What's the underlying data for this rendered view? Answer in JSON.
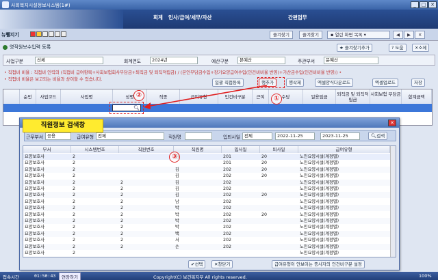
{
  "window": {
    "title": "사회복지시설정보시스템(1#)"
  },
  "menu": [
    "회계",
    "인사/급여/세무/자산",
    "간편업무"
  ],
  "nav": {
    "left_label": "뉴쀙지기",
    "buttons": [
      "즐겨찾기",
      "즐겨찾기",
      "열린 화면 목록"
    ]
  },
  "form": {
    "title": "영직원보수입력 등록",
    "fav_label": "즐겨찾기추가",
    "help_label": "도움",
    "close_label": "소제",
    "fields": [
      {
        "label": "사업구분",
        "value": "선체"
      },
      {
        "label": "회계연도",
        "value": "2024년"
      },
      {
        "label": "예산구분",
        "value": "본예산"
      },
      {
        "label": "주관부서",
        "value": "문예산"
      }
    ],
    "note1": "• 직접비 비율 : 직접비 인력의 (직접비 급여항목+사회보험회사부담금+퇴직금 및 퇴직적립금) / (본인부담금수입+장기요양급여수입(인건비비율 반영)+가산금수입(인건비비율 반영)) •",
    "note2": "• 직접비 비율은 보고되는 비율과 상이할 수 있습니다.",
    "buttons": [
      "일괄 직접등록",
      "행추가",
      "행삭제",
      "엑셀양식다운로드",
      "엑셀업로드",
      "저장"
    ]
  },
  "grid": {
    "headers": [
      "순번",
      "사업코드",
      "사업명",
      "성명",
      "직종",
      "급여유형",
      "인건비구분",
      "근여",
      "수당",
      "일용임금",
      "퇴직금 및 퇴직적립금",
      "사회보험 부담금",
      "합계금액"
    ]
  },
  "dialog": {
    "label": "직원정보 검색창",
    "search": {
      "dept_label": "근무부서",
      "dept_value": "응용",
      "type_label": "급여유형",
      "type_value": "전체",
      "name_label": "직원명",
      "date_label": "입퇴사일",
      "date_sel": "전체",
      "date_from": "2022-11-25",
      "date_to": "2023-11-25",
      "search_btn": "검색"
    },
    "headers": [
      "부서",
      "시스템번호",
      "직원번호",
      "직원명",
      "입사일",
      "퇴사일",
      "급여유형"
    ],
    "rows": [
      [
        "요양보호사",
        "2",
        "",
        "김",
        "201",
        "20",
        "노인요양시설(계정별)"
      ],
      [
        "요양보호사",
        "2",
        "",
        "",
        "201",
        "20",
        "노인요양시설(계정별)"
      ],
      [
        "요양보호사",
        "2",
        "",
        "김",
        "202",
        "20",
        "노인요양시설(계정별)"
      ],
      [
        "요양보호사",
        "2",
        "",
        "김",
        "202",
        "20",
        "노인요양시설(계정별)"
      ],
      [
        "요양보호사",
        "2",
        "2",
        "김",
        "202",
        "",
        "노인요양시설(계정별)"
      ],
      [
        "요양보호사",
        "2",
        "2",
        "김",
        "202",
        "",
        "노인요양시설(계정별)"
      ],
      [
        "요양보호사",
        "2",
        "2",
        "김",
        "202",
        "20",
        "노인요양시설(계정별)"
      ],
      [
        "요양보호사",
        "2",
        "2",
        "남",
        "202",
        "",
        "노인요양시설(계정별)"
      ],
      [
        "요양보호사",
        "2",
        "2",
        "박",
        "202",
        "",
        "노인요양시설(계정별)"
      ],
      [
        "요양보호사",
        "2",
        "2",
        "박",
        "202",
        "20",
        "노인요양시설(계정별)"
      ],
      [
        "요양보호사",
        "2",
        "2",
        "박",
        "202",
        "",
        "노인요양시설(계정별)"
      ],
      [
        "요양보호사",
        "2",
        "2",
        "박",
        "202",
        "",
        "노인요양시설(계정별)"
      ],
      [
        "요양보호사",
        "2",
        "2",
        "백",
        "202",
        "",
        "노인요양시설(계정별)"
      ],
      [
        "요양보호사",
        "2",
        "2",
        "서",
        "202",
        "",
        "노인요양시설(계정별)"
      ],
      [
        "요양보호사",
        "2",
        "2",
        "손",
        "202",
        "",
        "노인요양시설(계정별)"
      ],
      [
        "요양보호사",
        "2",
        "",
        "",
        "",
        "",
        "노인요양시설(계정별)"
      ]
    ],
    "select_btn": "선택",
    "close_btn": "창닫기",
    "footer_btn": "급여유형이 안보이는 종사자의 인건비구분 설정"
  },
  "annotations": {
    "one": "①",
    "two": "②",
    "three": "③"
  },
  "status": {
    "left": "접속시간",
    "time": "01:50:43",
    "extend": "연장하기",
    "copyright": "Copyright(C) 보건복지부 All rights reserved.",
    "zoom": "100%"
  },
  "colors": {
    "accent": "#2a4f93",
    "selected_row": "#3c77d9",
    "annotation": "#e02020",
    "label_bg": "#ffeb2f"
  }
}
